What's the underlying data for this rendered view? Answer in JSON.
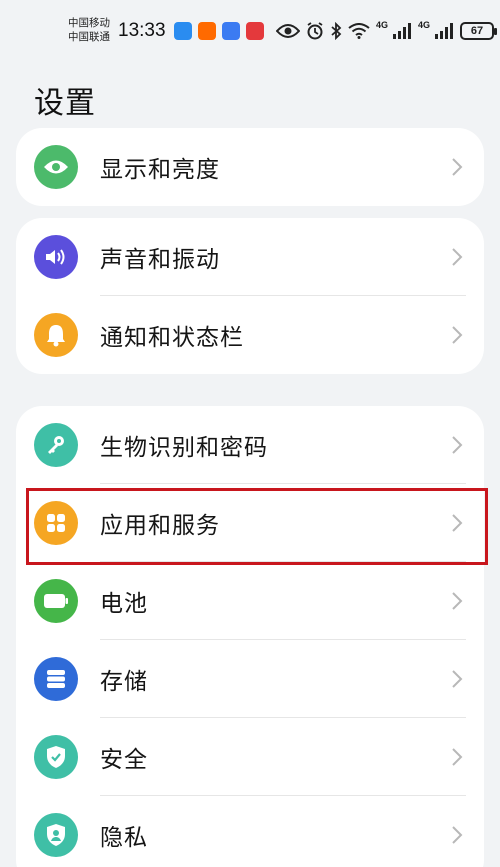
{
  "status": {
    "carrier1": "中国移动",
    "carrier2": "中国联通",
    "time": "13:33",
    "net1": "4G",
    "net2": "4G",
    "battery": "67"
  },
  "page": {
    "title": "设置"
  },
  "groups": [
    {
      "items": [
        {
          "label": "显示和亮度",
          "color": "#4cba6b",
          "icon": "eye-icon"
        }
      ]
    },
    {
      "items": [
        {
          "label": "声音和振动",
          "color": "#5b4fdc",
          "icon": "speaker-icon"
        },
        {
          "label": "通知和状态栏",
          "color": "#f5a623",
          "icon": "bell-icon"
        }
      ]
    },
    {
      "items": [
        {
          "label": "生物识别和密码",
          "color": "#3fbfa6",
          "icon": "key-icon"
        },
        {
          "label": "应用和服务",
          "color": "#f5a623",
          "icon": "apps-grid-icon"
        },
        {
          "label": "电池",
          "color": "#45b649",
          "icon": "battery-icon"
        },
        {
          "label": "存储",
          "color": "#2f6bd8",
          "icon": "storage-icon"
        },
        {
          "label": "安全",
          "color": "#3fbfa6",
          "icon": "shield-icon"
        },
        {
          "label": "隐私",
          "color": "#3fbfa6",
          "icon": "privacy-icon"
        }
      ]
    }
  ],
  "highlight_color": "#c8161d"
}
